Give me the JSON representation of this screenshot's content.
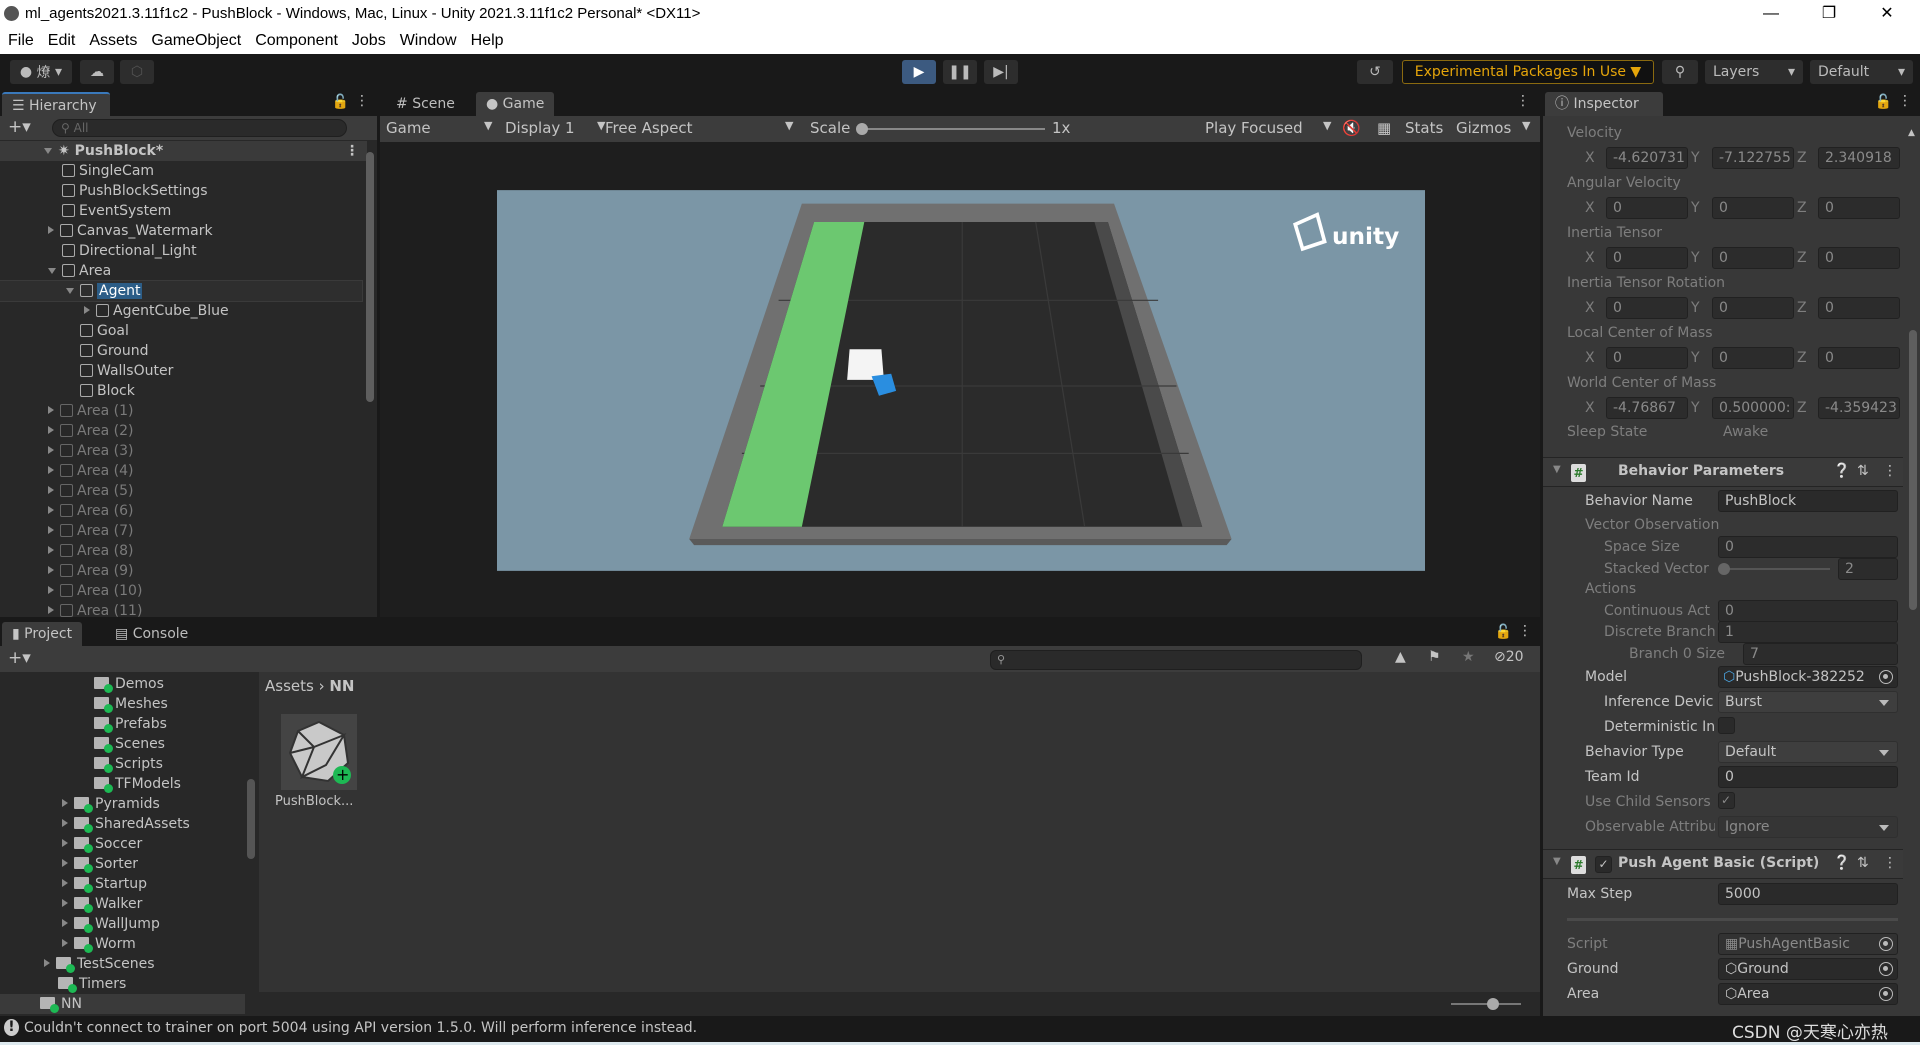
{
  "window": {
    "title": "ml_agents2021.3.11f1c2 - PushBlock - Windows, Mac, Linux - Unity 2021.3.11f1c2 Personal* <DX11>"
  },
  "menu": [
    "File",
    "Edit",
    "Assets",
    "GameObject",
    "Component",
    "Jobs",
    "Window",
    "Help"
  ],
  "toolbar": {
    "account_label": "燎",
    "experimental_label": "Experimental Packages In Use",
    "layers_label": "Layers",
    "layout_label": "Default",
    "warning_color": "#e5a50a"
  },
  "hierarchy": {
    "tab": "Hierarchy",
    "search_placeholder": "All",
    "scene": "PushBlock*",
    "items": [
      {
        "label": "SingleCam",
        "level": 1
      },
      {
        "label": "PushBlockSettings",
        "level": 1
      },
      {
        "label": "EventSystem",
        "level": 1
      },
      {
        "label": "Canvas_Watermark",
        "level": 1,
        "arrow": "right"
      },
      {
        "label": "Directional_Light",
        "level": 1
      },
      {
        "label": "Area",
        "level": 1,
        "arrow": "down"
      },
      {
        "label": "Agent",
        "level": 2,
        "arrow": "down",
        "selected": true
      },
      {
        "label": "AgentCube_Blue",
        "level": 3,
        "arrow": "right"
      },
      {
        "label": "Goal",
        "level": 2
      },
      {
        "label": "Ground",
        "level": 2
      },
      {
        "label": "WallsOuter",
        "level": 2
      },
      {
        "label": "Block",
        "level": 2
      },
      {
        "label": "Area (1)",
        "level": 1,
        "arrow": "right",
        "inactive": true
      },
      {
        "label": "Area (2)",
        "level": 1,
        "arrow": "right",
        "inactive": true
      },
      {
        "label": "Area (3)",
        "level": 1,
        "arrow": "right",
        "inactive": true
      },
      {
        "label": "Area (4)",
        "level": 1,
        "arrow": "right",
        "inactive": true
      },
      {
        "label": "Area (5)",
        "level": 1,
        "arrow": "right",
        "inactive": true
      },
      {
        "label": "Area (6)",
        "level": 1,
        "arrow": "right",
        "inactive": true
      },
      {
        "label": "Area (7)",
        "level": 1,
        "arrow": "right",
        "inactive": true
      },
      {
        "label": "Area (8)",
        "level": 1,
        "arrow": "right",
        "inactive": true
      },
      {
        "label": "Area (9)",
        "level": 1,
        "arrow": "right",
        "inactive": true
      },
      {
        "label": "Area (10)",
        "level": 1,
        "arrow": "right",
        "inactive": true
      },
      {
        "label": "Area (11)",
        "level": 1,
        "arrow": "right",
        "inactive": true
      }
    ]
  },
  "game": {
    "tabs": [
      "Scene",
      "Game"
    ],
    "mode": "Game",
    "display": "Display 1",
    "aspect": "Free Aspect",
    "scale_label": "Scale",
    "scale_value": "1x",
    "play_focused": "Play Focused",
    "stats": "Stats",
    "gizmos": "Gizmos",
    "logo_text": "unity",
    "sky_color": "#7b96a6",
    "goal_color": "#6cc870"
  },
  "project": {
    "tabs": [
      "Project",
      "Console"
    ],
    "breadcrumb": [
      "Assets",
      "NN"
    ],
    "hidden_count": "20",
    "tree": [
      {
        "label": "Demos",
        "level": 3
      },
      {
        "label": "Meshes",
        "level": 3
      },
      {
        "label": "Prefabs",
        "level": 3
      },
      {
        "label": "Scenes",
        "level": 3
      },
      {
        "label": "Scripts",
        "level": 3
      },
      {
        "label": "TFModels",
        "level": 3
      },
      {
        "label": "Pyramids",
        "level": 2,
        "arrow": true
      },
      {
        "label": "SharedAssets",
        "level": 2,
        "arrow": true
      },
      {
        "label": "Soccer",
        "level": 2,
        "arrow": true
      },
      {
        "label": "Sorter",
        "level": 2,
        "arrow": true
      },
      {
        "label": "Startup",
        "level": 2,
        "arrow": true
      },
      {
        "label": "Walker",
        "level": 2,
        "arrow": true
      },
      {
        "label": "WallJump",
        "level": 2,
        "arrow": true
      },
      {
        "label": "Worm",
        "level": 2,
        "arrow": true
      },
      {
        "label": "TestScenes",
        "level": 1,
        "arrow": true
      },
      {
        "label": "Timers",
        "level": 1
      },
      {
        "label": "NN",
        "level": 0,
        "selected": true
      }
    ],
    "asset": {
      "label": "PushBlock..."
    }
  },
  "inspector": {
    "tab": "Inspector",
    "rigidbody": [
      {
        "label": "Velocity",
        "x": "-4.620731",
        "y": "-7.122755",
        "z": "2.340918"
      },
      {
        "label": "Angular Velocity",
        "x": "0",
        "y": "0",
        "z": "0"
      },
      {
        "label": "Inertia Tensor",
        "x": "0",
        "y": "0",
        "z": "0"
      },
      {
        "label": "Inertia Tensor Rotation",
        "x": "0",
        "y": "0",
        "z": "0"
      },
      {
        "label": "Local Center of Mass",
        "x": "0",
        "y": "0",
        "z": "0"
      },
      {
        "label": "World Center of Mass",
        "x": "-4.76867",
        "y": "0.500000:",
        "z": "-4.359423"
      }
    ],
    "sleep_state": {
      "label": "Sleep State",
      "value": "Awake"
    },
    "behavior": {
      "title": "Behavior Parameters",
      "behavior_name_label": "Behavior Name",
      "behavior_name": "PushBlock",
      "vector_obs": "Vector Observation",
      "space_size_label": "Space Size",
      "space_size": "0",
      "stacked_label": "Stacked Vector",
      "stacked": "2",
      "actions": "Actions",
      "continuous_label": "Continuous Act",
      "continuous": "0",
      "discrete_label": "Discrete Branch",
      "discrete": "1",
      "branch0_label": "Branch 0 Size",
      "branch0": "7",
      "model_label": "Model",
      "model": "PushBlock-382252",
      "inference_label": "Inference Devic",
      "inference": "Burst",
      "deterministic_label": "Deterministic In",
      "type_label": "Behavior Type",
      "type": "Default",
      "team_label": "Team Id",
      "team": "0",
      "child_label": "Use Child Sensors",
      "observable_label": "Observable Attribu",
      "observable": "Ignore"
    },
    "agent": {
      "title": "Push Agent Basic (Script)",
      "max_step_label": "Max Step",
      "max_step": "5000",
      "script_label": "Script",
      "script": "PushAgentBasic",
      "ground_label": "Ground",
      "ground": "Ground",
      "area_label": "Area",
      "area": "Area"
    }
  },
  "status": {
    "message": "Couldn't connect to trainer on port 5004 using API version 1.5.0. Will perform inference instead.",
    "watermark": "CSDN @天寒心亦热"
  }
}
